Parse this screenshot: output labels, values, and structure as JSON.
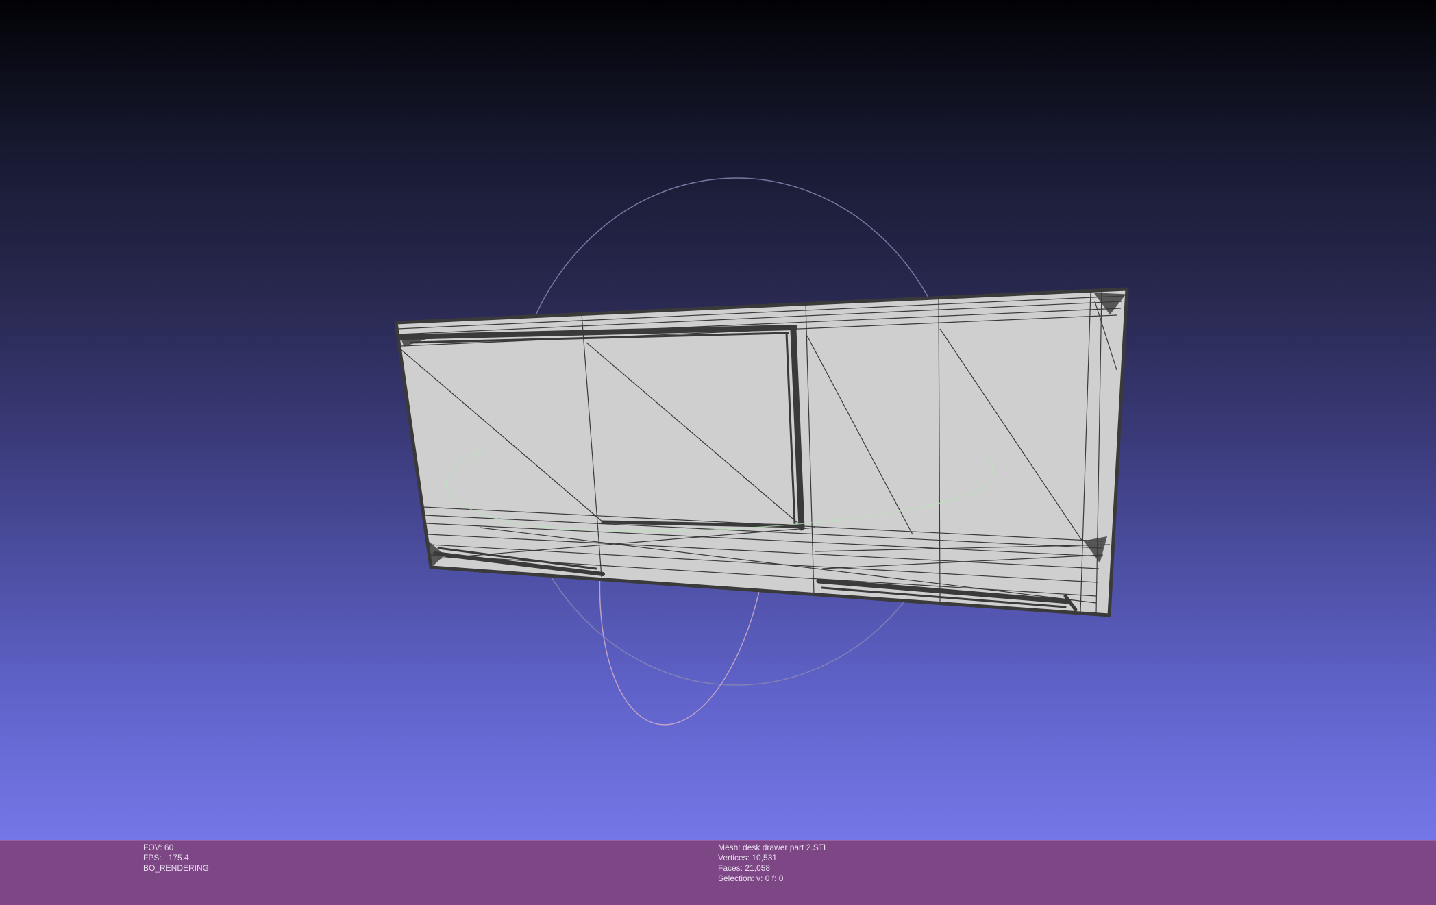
{
  "viewer": {
    "background_top": "#020205",
    "background_bottom": "#7577e8",
    "mesh_fill": "#cfcfcf",
    "wire_color": "#3a3a3a",
    "trackball_colors": {
      "horizontal": "#b8e6b8",
      "vertical": "#c9a8c8",
      "frontal": "#8888b8"
    }
  },
  "info_bar": {
    "left": {
      "fov": "FOV: 60",
      "fps": "FPS:   175.4",
      "render_mode": "BO_RENDERING"
    },
    "right": {
      "mesh": "Mesh: desk drawer part 2.STL",
      "vertices": "Vertices: 10,531",
      "faces": "Faces: 21,058",
      "selection": "Selection: v: 0 f: 0"
    }
  }
}
